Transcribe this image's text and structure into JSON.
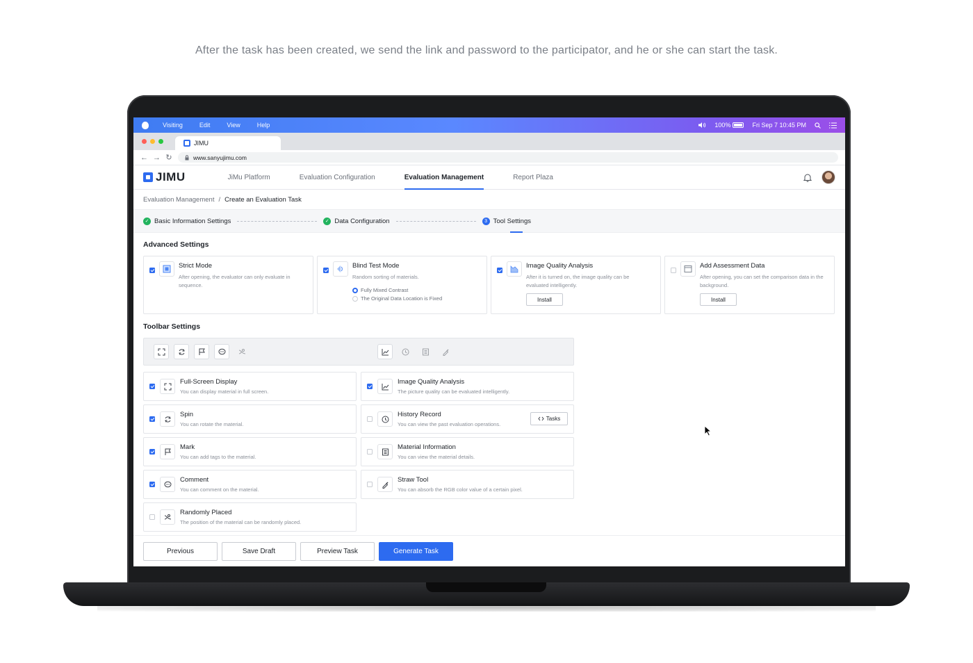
{
  "caption": "After the task has been created, we send the link and password to the participator, and he or she can start the task.",
  "menubar": {
    "items": [
      "Visiting",
      "Edit",
      "View",
      "Help"
    ],
    "battery": "100%",
    "datetime": "Fri Sep 7 10:45 PM"
  },
  "browser": {
    "tab_title": "JIMU",
    "url": "www.sanyujimu.com"
  },
  "app": {
    "logo": "JIMU",
    "nav": [
      "JiMu Platform",
      "Evaluation Configuration",
      "Evaluation Management",
      "Report Plaza"
    ],
    "active_nav": "Evaluation Management"
  },
  "breadcrumb": {
    "parent": "Evaluation Management",
    "separator": "/",
    "current": "Create an Evaluation Task"
  },
  "steps": [
    {
      "label": "Basic Information Settings",
      "status": "done"
    },
    {
      "label": "Data Configuration",
      "status": "done"
    },
    {
      "label": "Tool Settings",
      "status": "active",
      "number": "3"
    }
  ],
  "advanced": {
    "title": "Advanced Settings",
    "cards": [
      {
        "title": "Strict Mode",
        "desc": "After opening, the evaluator can only evaluate in sequence.",
        "checked": true
      },
      {
        "title": "Blind Test Mode",
        "desc": "Random sorting of materials.",
        "checked": true,
        "options": [
          "Fully Mixed Contrast",
          "The Original Data Location is Fixed"
        ]
      },
      {
        "title": "Image Quality Analysis",
        "desc": "After it is turned on, the image quality can be evaluated intelligently.",
        "checked": true,
        "button": "Install"
      },
      {
        "title": "Add Assessment Data",
        "desc": "After opening, you can set the comparison data in the background.",
        "checked": false,
        "button": "Install"
      }
    ]
  },
  "toolbar": {
    "title": "Toolbar Settings",
    "tools": [
      {
        "title": "Full-Screen Display",
        "desc": "You can display material in full screen.",
        "checked": true,
        "icon": "fullscreen-icon"
      },
      {
        "title": "Image Quality Analysis",
        "desc": "The picture quality can be evaluated intelligently.",
        "checked": true,
        "icon": "chart-icon"
      },
      {
        "title": "Spin",
        "desc": "You can rotate the material.",
        "checked": true,
        "icon": "rotate-icon"
      },
      {
        "title": "History Record",
        "desc": "You can view the past evaluation operations.",
        "checked": false,
        "icon": "clock-icon",
        "button": "Tasks"
      },
      {
        "title": "Mark",
        "desc": "You can add tags to the material.",
        "checked": true,
        "icon": "flag-icon"
      },
      {
        "title": "Material Information",
        "desc": "You can view the material details.",
        "checked": false,
        "icon": "document-icon"
      },
      {
        "title": "Comment",
        "desc": "You can comment on the material.",
        "checked": true,
        "icon": "comment-icon"
      },
      {
        "title": "Straw Tool",
        "desc": "You can absorb the RGB color value of a certain pixel.",
        "checked": false,
        "icon": "eyedropper-icon"
      },
      {
        "title": "Randomly Placed",
        "desc": "The position of the material can be randomly placed.",
        "checked": false,
        "icon": "shuffle-icon"
      }
    ]
  },
  "footer": {
    "previous": "Previous",
    "save_draft": "Save Draft",
    "preview": "Preview Task",
    "generate": "Generate Task"
  },
  "colors": {
    "accent": "#2d6bf0",
    "success": "#22b35e"
  }
}
